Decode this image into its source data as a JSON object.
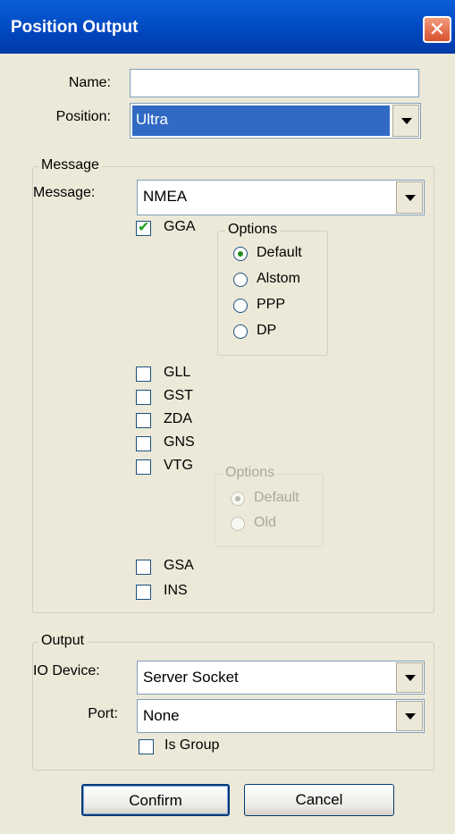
{
  "window": {
    "title": "Position Output",
    "close_icon": "close-icon"
  },
  "name_field": {
    "label": "Name:",
    "value": ""
  },
  "position_field": {
    "label": "Position:",
    "value": "Ultra"
  },
  "message_group": {
    "legend": "Message",
    "label": "Message:",
    "value": "NMEA",
    "items": [
      {
        "label": "GGA",
        "checked": true
      },
      {
        "label": "GLL",
        "checked": false
      },
      {
        "label": "GST",
        "checked": false
      },
      {
        "label": "ZDA",
        "checked": false
      },
      {
        "label": "GNS",
        "checked": false
      },
      {
        "label": "VTG",
        "checked": false
      },
      {
        "label": "GSA",
        "checked": false
      },
      {
        "label": "INS",
        "checked": false
      }
    ],
    "gga_options": {
      "legend": "Options",
      "selected": "Default",
      "items": [
        "Default",
        "Alstom",
        "PPP",
        "DP"
      ]
    },
    "vtg_options": {
      "legend": "Options",
      "enabled": false,
      "selected": "Default",
      "items": [
        "Default",
        "Old"
      ]
    }
  },
  "output_group": {
    "legend": "Output",
    "io_label": "IO Device:",
    "io_value": "Server Socket",
    "port_label": "Port:",
    "port_value": "None",
    "is_group_label": "Is Group",
    "is_group_checked": false
  },
  "buttons": {
    "confirm": "Confirm",
    "cancel": "Cancel"
  },
  "colors": {
    "titlebar": "#0054e3",
    "selection": "#316ac5",
    "dialog_bg": "#ece9d8",
    "close": "#d9512f"
  }
}
